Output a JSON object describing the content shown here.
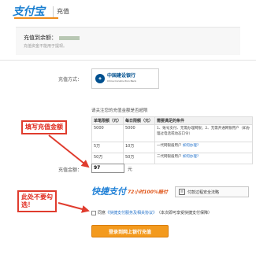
{
  "header": {
    "logo_text": "支付宝",
    "title": "充值"
  },
  "account": {
    "label": "充值到余额：",
    "sub_note": "充值资金不能用于提现。"
  },
  "form": {
    "method_label": "充值方式：",
    "bank_name": "中国建设银行",
    "bank_name_en": "China Construction Bank",
    "limit_notice": "请关注您的充值金额是否超限",
    "amount_label": "充值金额：",
    "amount_value": "97",
    "amount_unit": "元"
  },
  "limits_table": {
    "headers": [
      "单笔限额（元）",
      "每日限额（元）",
      "需要满足的条件"
    ],
    "rows": [
      {
        "single": "5000",
        "daily": "5000",
        "cond": "1、账号支付、无需办理网银；2、无需开通网银用户（如办理过电话或动态口令）",
        "link": ""
      },
      {
        "single": "5万",
        "daily": "10万",
        "cond": "一代网银盾用户",
        "link": "如何办理?"
      },
      {
        "single": "50万",
        "daily": "50万",
        "cond": "二代网银盾用户",
        "link": "如何办理?"
      }
    ]
  },
  "promo": {
    "main": "快捷支付",
    "sub": "72小时100%赔付",
    "safe_button": "付款过程安全法略"
  },
  "agreement": {
    "prefix": "同意",
    "link": "《快捷支付服务及相关协议》",
    "suffix": "（本次即可享受快捷支付保障）"
  },
  "submit_label": "登录到网上银行充值",
  "annotations": {
    "amount_callout": "填写充值金额",
    "checkbox_callout": "此处不要勾选！"
  },
  "colors": {
    "brand_blue": "#1a7fd0",
    "accent_orange": "#f39a1e",
    "annotation_red": "#e03c2e"
  }
}
